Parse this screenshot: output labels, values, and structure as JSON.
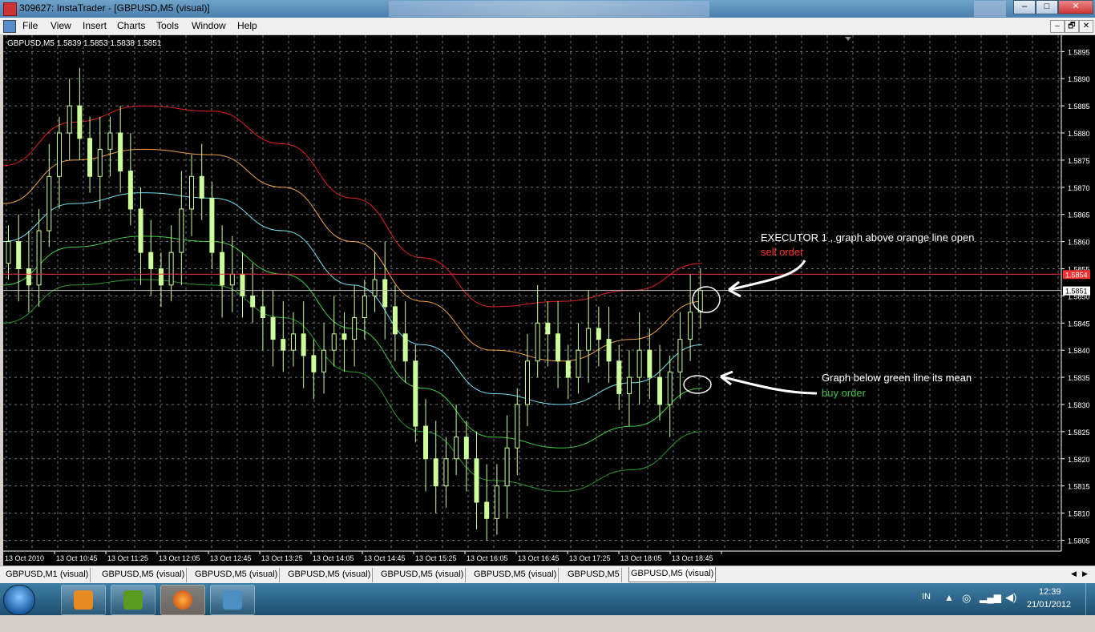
{
  "window": {
    "title": "309627: InstaTrader - [GBPUSD,M5 (visual)]",
    "buttons": [
      "–",
      "□",
      "✕"
    ]
  },
  "menu": {
    "items": [
      "File",
      "View",
      "Insert",
      "Charts",
      "Tools",
      "Window",
      "Help"
    ],
    "mdi_buttons": [
      "–",
      "🗗",
      "✕"
    ]
  },
  "chart": {
    "header": "GBPUSD,M5  1.5839 1.5853 1.5838 1.5851",
    "price_labels": [
      "1.5895",
      "1.5890",
      "1.5885",
      "1.5880",
      "1.5875",
      "1.5870",
      "1.5865",
      "1.5860",
      "1.5855",
      "1.5850",
      "1.5845",
      "1.5840",
      "1.5835",
      "1.5830",
      "1.5825",
      "1.5820",
      "1.5815",
      "1.5810",
      "1.5805"
    ],
    "time_labels": [
      "13 Oct 2010",
      "13 Oct 10:45",
      "13 Oct 11:25",
      "13 Oct 12:05",
      "13 Oct 12:45",
      "13 Oct 13:25",
      "13 Oct 14:05",
      "13 Oct 14:45",
      "13 Oct 15:25",
      "13 Oct 16:05",
      "13 Oct 16:45",
      "13 Oct 17:25",
      "13 Oct 18:05",
      "13 Oct 18:45"
    ],
    "ask_label": "1.5854",
    "bid_label": "1.5851",
    "colors": {
      "background": "#000000",
      "grid": "#6c7680",
      "candle": "#ccff99",
      "red_band": "#e02020",
      "orange_band": "#f0a040",
      "cyan_band": "#70e0f0",
      "green_band": "#40d040",
      "dark_green_band": "#2a9a2a",
      "ask_line": "#ff3030",
      "bid_line": "#c0c0c0"
    },
    "annotations": {
      "sell_line1": "EXECUTOR 1 , graph above orange line  open",
      "sell_line2": "sell order",
      "buy_line1": "Graph below green line its mean",
      "buy_line2": "buy order"
    }
  },
  "chart_data": {
    "type": "candlestick",
    "symbol": "GBPUSD",
    "timeframe": "M5",
    "ylim": [
      1.5803,
      1.5898
    ],
    "bands": [
      {
        "color": "red",
        "values": [
          1.5874,
          1.5882,
          1.5885,
          1.5884,
          1.5878,
          1.5868,
          1.5857,
          1.5848,
          1.5849,
          1.5851,
          1.5856
        ]
      },
      {
        "color": "orange",
        "values": [
          1.5867,
          1.5875,
          1.5877,
          1.5876,
          1.587,
          1.586,
          1.5849,
          1.584,
          1.5838,
          1.5842,
          1.5849
        ]
      },
      {
        "color": "cyan",
        "values": [
          1.586,
          1.5867,
          1.5869,
          1.5868,
          1.5862,
          1.5852,
          1.5841,
          1.5832,
          1.583,
          1.5834,
          1.5841
        ]
      },
      {
        "color": "green",
        "values": [
          1.5852,
          1.5859,
          1.5861,
          1.586,
          1.5854,
          1.5844,
          1.5833,
          1.5824,
          1.5822,
          1.5826,
          1.5833
        ]
      },
      {
        "color": "dark-green",
        "values": [
          1.5845,
          1.5852,
          1.5853,
          1.5852,
          1.5846,
          1.5836,
          1.5825,
          1.5816,
          1.5814,
          1.5818,
          1.5825
        ]
      }
    ],
    "close": [
      1.586,
      1.5855,
      1.5852,
      1.5862,
      1.5872,
      1.588,
      1.5885,
      1.5879,
      1.5872,
      1.5877,
      1.588,
      1.5873,
      1.5866,
      1.5858,
      1.5855,
      1.5852,
      1.5858,
      1.5866,
      1.5872,
      1.5868,
      1.5858,
      1.5852,
      1.5854,
      1.585,
      1.5848,
      1.5846,
      1.5842,
      1.584,
      1.5843,
      1.5839,
      1.5836,
      1.584,
      1.5843,
      1.5842,
      1.5846,
      1.585,
      1.5853,
      1.5848,
      1.5843,
      1.5838,
      1.5826,
      1.582,
      1.5815,
      1.582,
      1.5824,
      1.582,
      1.5812,
      1.5809,
      1.5815,
      1.5822,
      1.583,
      1.5838,
      1.5845,
      1.5843,
      1.5838,
      1.5835,
      1.584,
      1.5844,
      1.5842,
      1.5838,
      1.5832,
      1.5835,
      1.584,
      1.5835,
      1.583,
      1.5836,
      1.5842,
      1.5847,
      1.5851
    ]
  }
}
